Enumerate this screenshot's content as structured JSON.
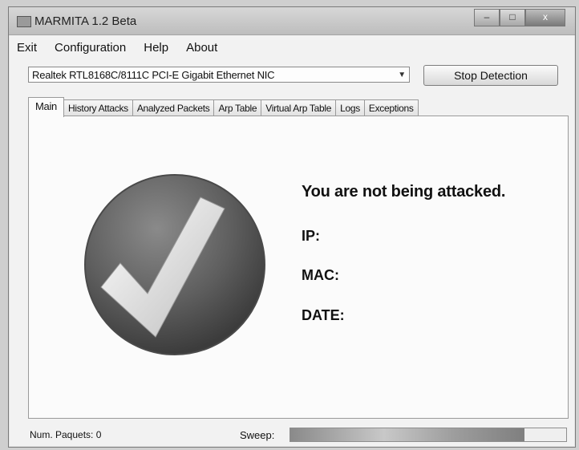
{
  "window": {
    "title": "MARMITA 1.2 Beta",
    "controls": {
      "minimize": "–",
      "maximize": "□",
      "close": "x"
    }
  },
  "menu": [
    "Exit",
    "Configuration",
    "Help",
    "About"
  ],
  "nic": {
    "selected": "Realtek RTL8168C/8111C PCI-E Gigabit Ethernet NIC"
  },
  "stop_button": "Stop Detection",
  "tabs": [
    "Main",
    "History Attacks",
    "Analyzed Packets",
    "Arp Table",
    "Virtual Arp Table",
    "Logs",
    "Exceptions"
  ],
  "main": {
    "status": "You are not being attacked.",
    "ip_label": "IP:",
    "mac_label": "MAC:",
    "date_label": "DATE:"
  },
  "statusbar": {
    "packets": "Num. Paquets: 0",
    "sweep_label": "Sweep:",
    "sweep_progress": 0.85
  },
  "icons": {
    "status": "checkmark-icon",
    "dropdown": "chevron-down-icon",
    "app": "app-icon"
  },
  "colors": {
    "badge": "#5a5a5a",
    "check": "#e8e8e8"
  }
}
